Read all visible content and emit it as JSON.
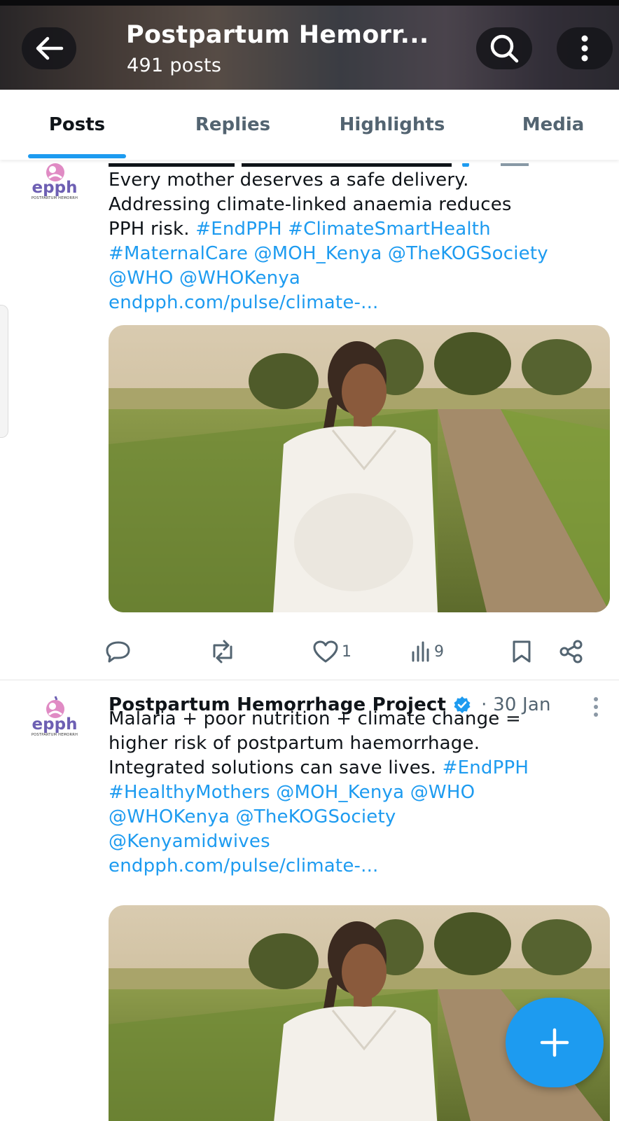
{
  "header": {
    "title": "Postpartum Hemorr...",
    "post_count": "491 posts",
    "icons": {
      "back": "arrow-left-icon",
      "search": "search-icon",
      "more": "more-vertical-icon"
    }
  },
  "tabs": [
    {
      "label": "Posts",
      "active": true
    },
    {
      "label": "Replies",
      "active": false
    },
    {
      "label": "Highlights",
      "active": false
    },
    {
      "label": "Media",
      "active": false
    }
  ],
  "avatar": {
    "wordmark": "epph",
    "tagline": "POSTPARTUM HEMORRH"
  },
  "posts": [
    {
      "lines": [
        "Every mother deserves a safe delivery.",
        "Addressing climate-linked anaemia reduces"
      ],
      "line3_text": "PPH risk. ",
      "line3_tags": "#EndPPH #ClimateSmartHealth",
      "link_lines": [
        "#MaternalCare @MOH_Kenya @TheKOGSociety",
        "@WHO @WHOKenya",
        "endpph.com/pulse/climate-..."
      ],
      "stats": {
        "replies": "",
        "reposts": "",
        "likes": "1",
        "views": "9"
      }
    },
    {
      "author": "Postpartum Hemorrhage Project",
      "verified": true,
      "date": "· 30 Jan",
      "lines": [
        "Malaria + poor nutrition + climate change =",
        "higher risk of postpartum haemorrhage."
      ],
      "line3_text": "Integrated solutions can save lives. ",
      "line3_tags": "#EndPPH",
      "link_lines": [
        "#HealthyMothers @MOH_Kenya @WHO",
        "@WHOKenya @TheKOGSociety",
        "@Kenyamidwives",
        "endpph.com/pulse/climate-..."
      ]
    }
  ],
  "colors": {
    "accent": "#1d9bf0",
    "text": "#0f1419",
    "muted": "#536471"
  }
}
